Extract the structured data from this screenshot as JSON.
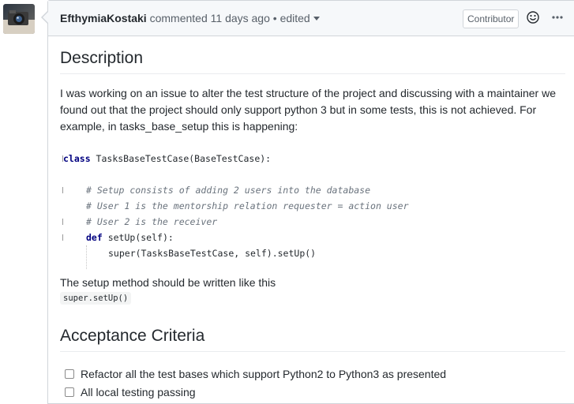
{
  "header": {
    "author": "EfthymiaKostaki",
    "action": " commented ",
    "time": "11 days ago",
    "separator": " • ",
    "edited": "edited",
    "badge": "Contributor"
  },
  "description": {
    "heading": "Description",
    "paragraph": "I was working on an issue to alter the test structure of the project and discussing with a maintainer we found out that the project should only support python 3 but in some tests, this is not achieved. For example, in tasks_base_setup this is happening:",
    "code": {
      "class_kw": "class",
      "class_rest": " TasksBaseTestCase(BaseTestCase):",
      "comment1": "# Setup consists of adding 2 users into the database",
      "comment2": "# User 1 is the mentorship relation requester = action user",
      "comment3": "# User 2 is the receiver",
      "def_kw": "def",
      "def_rest": " setUp(self):",
      "body": "super(TasksBaseTestCase, self).setUp()"
    },
    "setup_note": "The setup method should be written like this",
    "inline_code": "super.setUp()"
  },
  "acceptance": {
    "heading": "Acceptance Criteria",
    "items": [
      "Refactor all the test bases which support Python2 to Python3 as presented",
      "All local testing passing"
    ]
  },
  "icons": {
    "avatar": "camera-photo-avatar",
    "reaction": "smiley-icon",
    "more": "kebab-horizontal-icon"
  }
}
